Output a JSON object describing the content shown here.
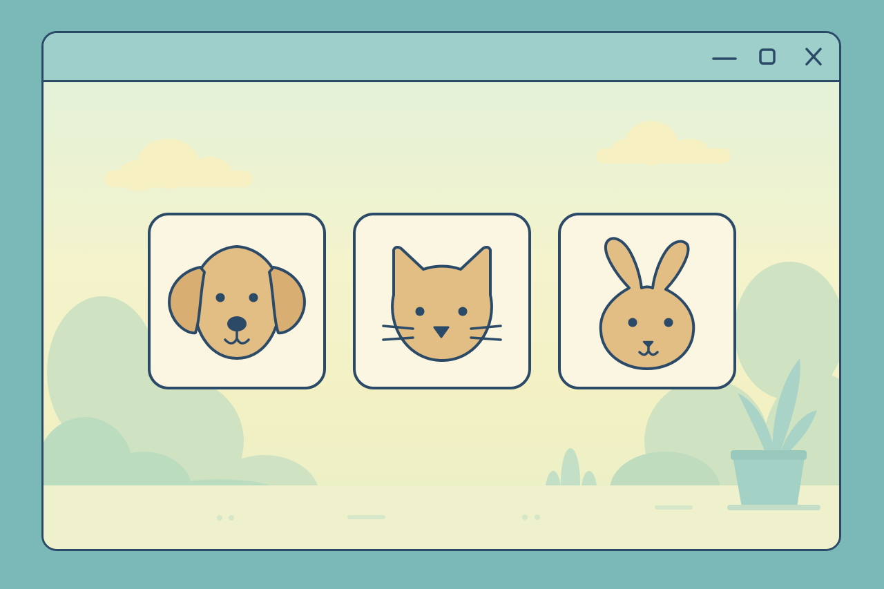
{
  "window": {
    "controls": [
      {
        "name": "minimize",
        "icon": "minimize-icon"
      },
      {
        "name": "maximize",
        "icon": "maximize-icon"
      },
      {
        "name": "close",
        "icon": "close-icon"
      }
    ]
  },
  "tiles": [
    {
      "animal": "dog",
      "icon": "dog-face-icon"
    },
    {
      "animal": "cat",
      "icon": "cat-face-icon"
    },
    {
      "animal": "rabbit",
      "icon": "rabbit-face-icon"
    }
  ],
  "colors": {
    "desktop": "#7bb8b8",
    "titlebar": "#9fcfcb",
    "outline": "#2b4a68",
    "tile": "#fbf6e1",
    "animal_fill": "#e2bd84",
    "foliage": "#c6e0c2"
  }
}
